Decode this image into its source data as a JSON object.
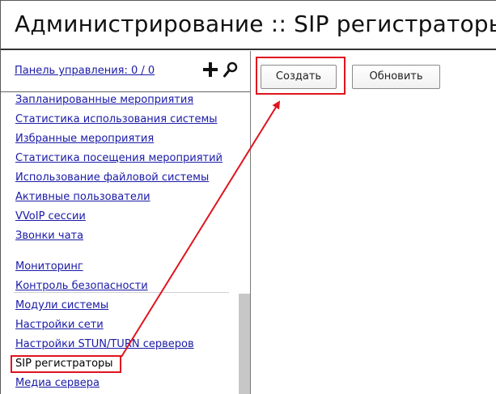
{
  "header": {
    "title": "Администрирование :: SIP регистраторы"
  },
  "sidebar": {
    "panel_link": "Панель управления: 0 / 0",
    "icons": [
      "plus-icon",
      "search-icon"
    ],
    "items": [
      {
        "label": "Запланированные мероприятия",
        "active": false
      },
      {
        "label": "Статистика использования системы",
        "active": false
      },
      {
        "label": "Избранные мероприятия",
        "active": false
      },
      {
        "label": "Статистика посещения мероприятий",
        "active": false
      },
      {
        "label": "Использование файловой системы",
        "active": false
      },
      {
        "label": "Активные пользователи",
        "active": false
      },
      {
        "label": "VVoIP сессии",
        "active": false
      },
      {
        "label": "Звонки чата",
        "active": false
      },
      {
        "label": "Мониторинг",
        "active": false
      },
      {
        "label": "Контроль безопасности",
        "active": false
      },
      {
        "label": "Модули системы",
        "active": false
      },
      {
        "label": "Настройки сети",
        "active": false
      },
      {
        "label": "Настройки STUN/TURN серверов",
        "active": false
      },
      {
        "label": "SIP регистраторы",
        "active": true
      },
      {
        "label": "Медиа сервера",
        "active": false
      }
    ]
  },
  "toolbar": {
    "create_label": "Создать",
    "refresh_label": "Обновить"
  },
  "colors": {
    "link": "#1a1aa8",
    "highlight": "#e0141f",
    "border": "#5a5a5a"
  }
}
